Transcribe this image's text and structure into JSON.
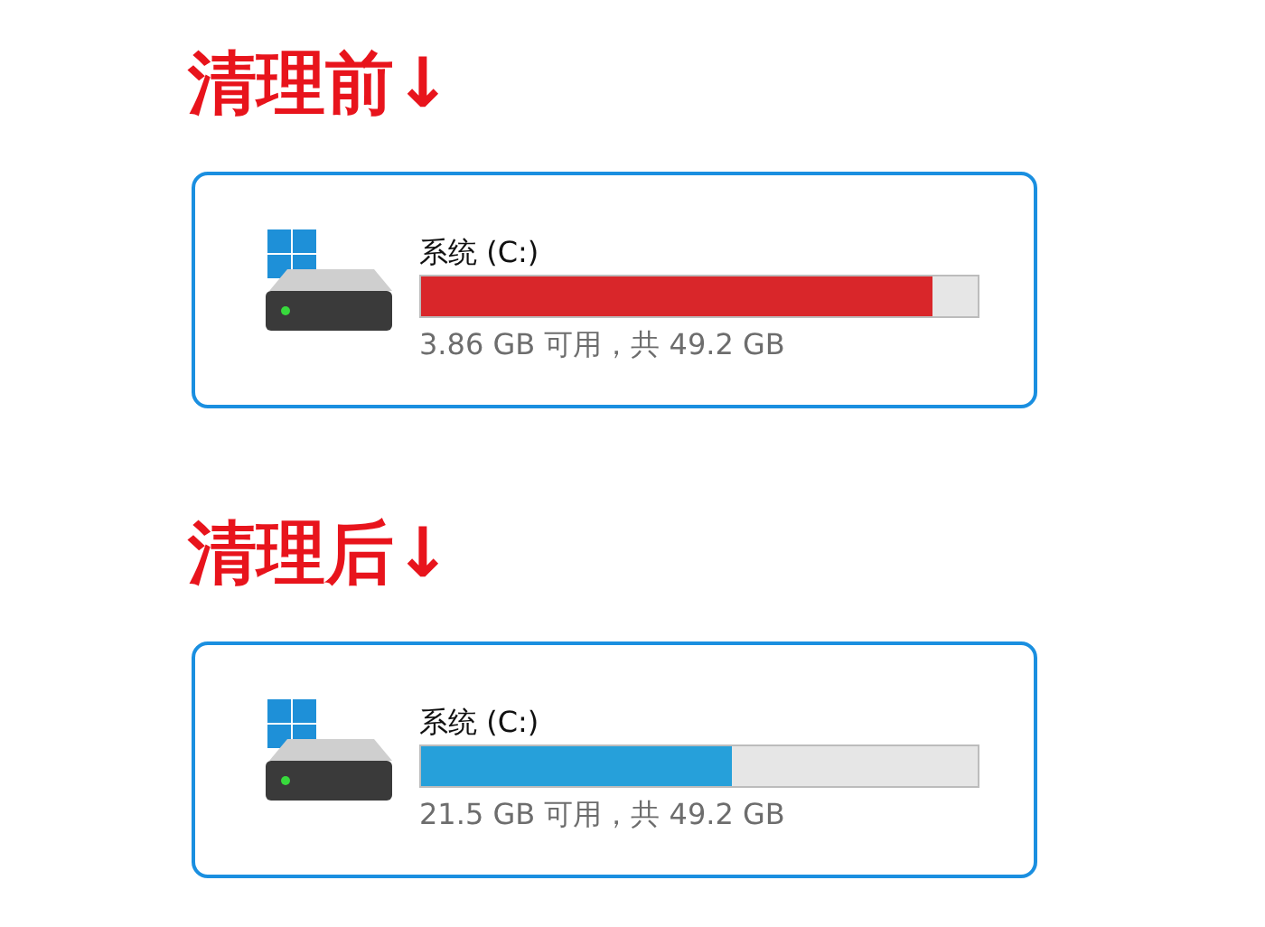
{
  "sections": [
    {
      "heading": "清理前↓",
      "drive": {
        "name": "系统 (C:)",
        "level": 0.92,
        "color": "#d9262a",
        "space": "3.86 GB 可用，共 49.2 GB"
      }
    },
    {
      "heading": "清理后↓",
      "drive": {
        "name": "系统 (C:)",
        "level": 0.56,
        "color": "#26a0da",
        "space": "21.5 GB 可用，共 49.2 GB"
      }
    }
  ]
}
